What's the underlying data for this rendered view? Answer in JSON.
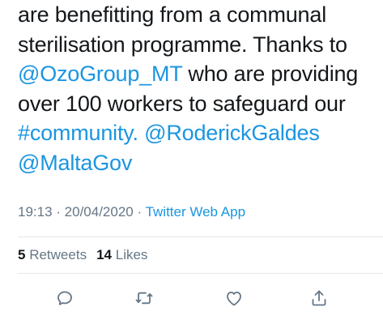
{
  "tweet": {
    "lines": [
      [
        {
          "text": "are benefitting from a communal",
          "link": false
        }
      ],
      [
        {
          "text": "sterilisation programme. Thanks to",
          "link": false
        }
      ],
      [
        {
          "text": "@OzoGroup_MT",
          "link": true
        },
        {
          "text": " who are providing",
          "link": false
        }
      ],
      [
        {
          "text": "over 100 workers to safeguard our",
          "link": false
        }
      ],
      [
        {
          "text": "#community.",
          "link": true
        },
        {
          "text": " ",
          "link": false
        },
        {
          "text": "@RoderickGaldes",
          "link": true
        }
      ],
      [
        {
          "text": "@MaltaGov",
          "link": true
        }
      ]
    ]
  },
  "meta": {
    "time": "19:13",
    "separator1": " · ",
    "date": "20/04/2020",
    "separator2": " · ",
    "source": "Twitter Web App"
  },
  "stats": {
    "retweets_count": "5",
    "retweets_label": "Retweets",
    "likes_count": "14",
    "likes_label": "Likes"
  },
  "actions": [
    {
      "name": "reply",
      "icon": "reply-icon"
    },
    {
      "name": "retweet",
      "icon": "retweet-icon"
    },
    {
      "name": "like",
      "icon": "heart-icon"
    },
    {
      "name": "share",
      "icon": "share-icon"
    }
  ],
  "colors": {
    "link": "#1b95e0",
    "text": "#14171a",
    "secondary": "#657786",
    "divider": "#e1e8ed"
  }
}
